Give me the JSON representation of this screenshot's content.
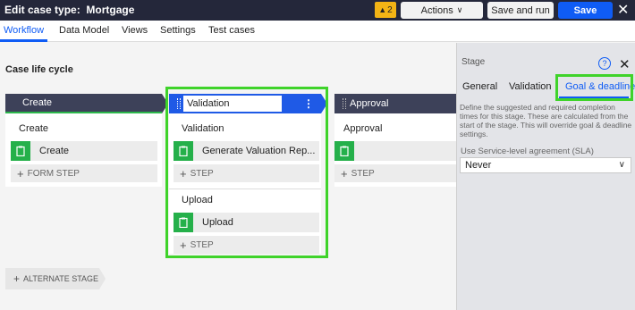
{
  "header": {
    "title_prefix": "Edit case type:",
    "title_name": "Mortgage",
    "warning_count": "2",
    "actions_label": "Actions",
    "save_run_label": "Save and run",
    "save_label": "Save",
    "close_glyph": "✕"
  },
  "tabs": [
    "Workflow",
    "Data Model",
    "Views",
    "Settings",
    "Test cases"
  ],
  "canvas": {
    "title": "Case life cycle",
    "stages": {
      "create": {
        "name": "Create",
        "process": "Create",
        "step": "Create",
        "add_step": "FORM STEP"
      },
      "validation": {
        "name": "Validation",
        "process1": "Validation",
        "step1": "Generate Valuation Rep...",
        "add_step1": "STEP",
        "process2": "Upload",
        "step2": "Upload",
        "add_step2": "STEP"
      },
      "approval": {
        "name": "Approval",
        "process": "Approval",
        "step": "",
        "add_step": "STEP"
      }
    },
    "alternate_stage": "ALTERNATE STAGE"
  },
  "panel": {
    "label": "Stage",
    "help_glyph": "?",
    "close_glyph": "✕",
    "tabs": [
      "General",
      "Validation",
      "Goal & deadline"
    ],
    "description": "Define the suggested and required completion times for this stage. These are calculated from the start of the stage. This will override goal & deadline settings.",
    "sla_label": "Use Service-level agreement (SLA)",
    "sla_value": "Never"
  },
  "colors": {
    "accent": "#0f5cf5",
    "step_icon": "#25b04a",
    "highlight": "#3fd32a",
    "topbar": "#24273a"
  }
}
